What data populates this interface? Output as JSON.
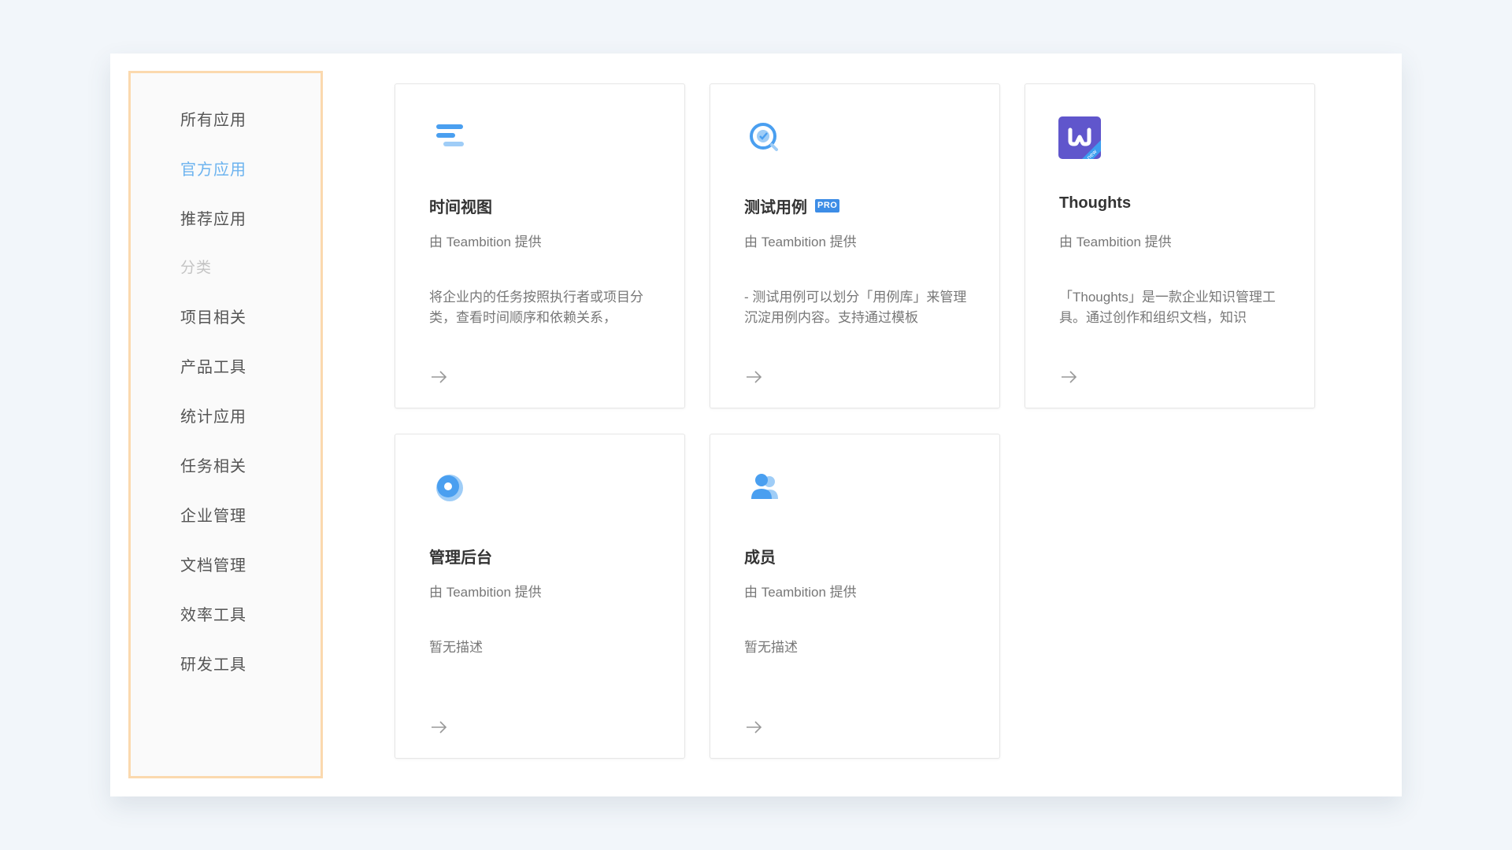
{
  "sidebar": {
    "items": [
      {
        "id": "all",
        "label": "所有应用",
        "active": false
      },
      {
        "id": "official",
        "label": "官方应用",
        "active": true
      },
      {
        "id": "recommended",
        "label": "推荐应用",
        "active": false
      }
    ],
    "category_heading": "分类",
    "categories": [
      {
        "id": "project",
        "label": "项目相关"
      },
      {
        "id": "product",
        "label": "产品工具"
      },
      {
        "id": "stats",
        "label": "统计应用"
      },
      {
        "id": "task",
        "label": "任务相关"
      },
      {
        "id": "enterprise",
        "label": "企业管理"
      },
      {
        "id": "docs",
        "label": "文档管理"
      },
      {
        "id": "efficiency",
        "label": "效率工具"
      },
      {
        "id": "dev",
        "label": "研发工具"
      }
    ]
  },
  "apps": [
    {
      "title": "时间视图",
      "provider": "由 Teambition 提供",
      "description": "将企业内的任务按照执行者或项目分类，查看时间顺序和依赖关系，",
      "icon": "timeline-icon",
      "pro_badge": ""
    },
    {
      "title": "测试用例",
      "provider": "由 Teambition 提供",
      "description": "- 测试用例可以划分「用例库」来管理沉淀用例内容。支持通过模板",
      "icon": "test-case-icon",
      "pro_badge": "PRO"
    },
    {
      "title": "Thoughts",
      "provider": "由 Teambition 提供",
      "description": "「Thoughts」是一款企业知识管理工具。通过创作和组织文档，知识",
      "icon": "thoughts-logo-icon",
      "pro_badge": "",
      "ribbon": "new"
    },
    {
      "title": "管理后台",
      "provider": "由 Teambition 提供",
      "description": "暂无描述",
      "icon": "admin-gear-icon",
      "pro_badge": ""
    },
    {
      "title": "成员",
      "provider": "由 Teambition 提供",
      "description": "暂无描述",
      "icon": "members-icon",
      "pro_badge": ""
    }
  ],
  "colors": {
    "accent": "#6cb3ef",
    "sidebar_border": "#fbd9ae",
    "icon_blue": "#4a9ff0",
    "thoughts_purple": "#6056cc",
    "pro_badge": "#3d8de6"
  }
}
